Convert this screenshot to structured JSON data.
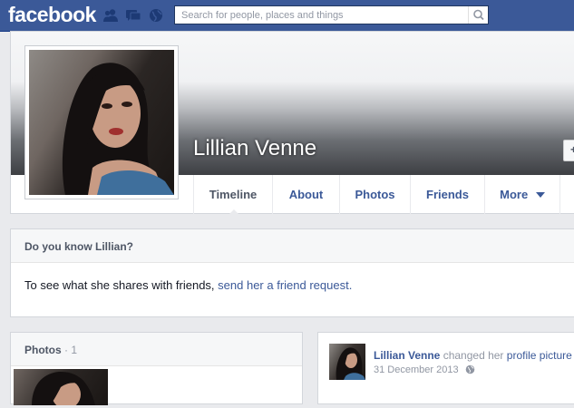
{
  "header": {
    "logo": "facebook",
    "search_placeholder": "Search for people, places and things",
    "icons": [
      "friend-requests-icon",
      "messages-icon",
      "notifications-globe-icon",
      "search-icon"
    ]
  },
  "profile": {
    "name": "Lillian Venne",
    "add_button_symbol": "+",
    "tabs": [
      {
        "label": "Timeline",
        "active": true
      },
      {
        "label": "About"
      },
      {
        "label": "Photos"
      },
      {
        "label": "Friends"
      },
      {
        "label": "More"
      }
    ]
  },
  "know": {
    "title": "Do you know Lillian?",
    "body_prefix": "To see what she shares with friends, ",
    "link_text": "send her a friend request."
  },
  "photos": {
    "title": "Photos",
    "count": "· 1"
  },
  "story": {
    "author": "Lillian Venne",
    "action": "changed her",
    "object": "profile picture",
    "date": "31 December 2013",
    "privacy_icon": "globe-icon"
  },
  "colors": {
    "brand": "#3b5998",
    "background": "#e9eaed",
    "muted": "#9197a3"
  }
}
